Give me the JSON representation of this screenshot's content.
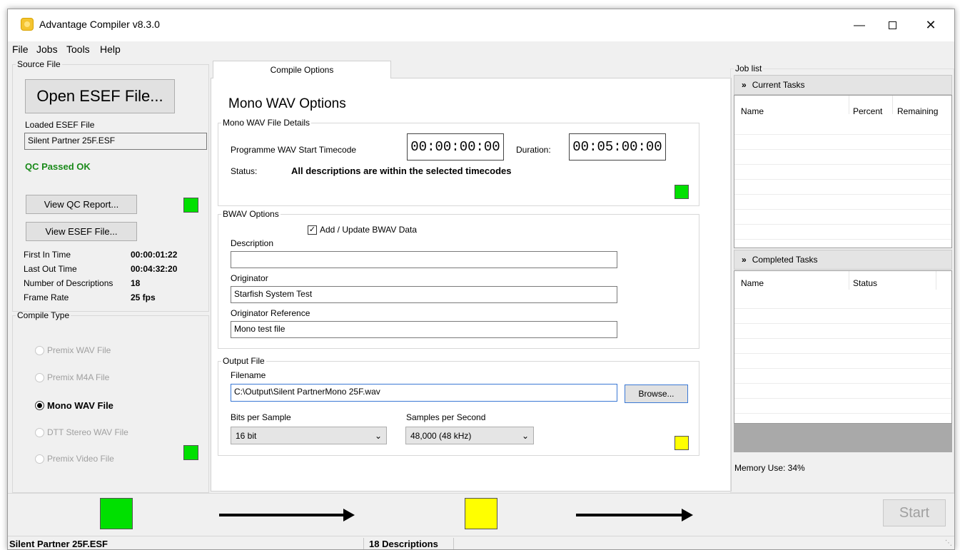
{
  "window": {
    "title": "Advantage Compiler v8.3.0"
  },
  "menu": [
    "File",
    "Jobs",
    "Tools",
    "Help"
  ],
  "source_file": {
    "legend": "Source File",
    "open_button": "Open ESEF File...",
    "loaded_label": "Loaded ESEF File",
    "loaded_value": "Silent Partner 25F.ESF",
    "qc_status": "QC Passed OK",
    "view_qc_button": "View QC Report...",
    "view_esef_button": "View ESEF File...",
    "stats": [
      {
        "label": "First In Time",
        "value": "00:00:01:22"
      },
      {
        "label": "Last Out Time",
        "value": "00:04:32:20"
      },
      {
        "label": "Number of Descriptions",
        "value": "18"
      },
      {
        "label": "Frame Rate",
        "value": "25 fps"
      }
    ]
  },
  "compile_type": {
    "legend": "Compile Type",
    "options": [
      {
        "label": "Premix WAV File"
      },
      {
        "label": "Premix M4A File"
      },
      {
        "label": "Mono WAV File"
      },
      {
        "label": "DTT Stereo WAV File"
      },
      {
        "label": "Premix Video File"
      }
    ],
    "selected": "Mono WAV File"
  },
  "tab": {
    "label": "Compile Options"
  },
  "options": {
    "heading": "Mono WAV Options",
    "details": {
      "legend": "Mono WAV File Details",
      "start_label": "Programme WAV Start Timecode",
      "start_value": "00:00:00:00",
      "duration_label": "Duration:",
      "duration_value": "00:05:00:00",
      "status_label": "Status:",
      "status_value": "All descriptions are within the selected timecodes"
    },
    "bwav": {
      "legend": "BWAV Options",
      "checkbox_label": "Add / Update BWAV Data",
      "checked": true,
      "description_label": "Description",
      "description_value": "",
      "originator_label": "Originator",
      "originator_value": "Starfish System Test",
      "reference_label": "Originator Reference",
      "reference_value": "Mono test file"
    },
    "output": {
      "legend": "Output File",
      "filename_label": "Filename",
      "filename_value": "C:\\Output\\Silent PartnerMono 25F.wav",
      "browse_button": "Browse...",
      "bits_label": "Bits per Sample",
      "bits_value": "16 bit",
      "samples_label": "Samples per Second",
      "samples_value": "48,000 (48 kHz)"
    }
  },
  "job_list": {
    "legend": "Job list",
    "current": {
      "title": "Current Tasks",
      "columns": [
        "Name",
        "Percent",
        "Remaining"
      ]
    },
    "completed": {
      "title": "Completed Tasks",
      "columns": [
        "Name",
        "Status"
      ]
    },
    "memory": "Memory Use: 34%"
  },
  "start_button": "Start",
  "statusbar": {
    "file": "Silent Partner 25F.ESF",
    "descriptions": "18 Descriptions"
  },
  "colors": {
    "ok": "#00e000",
    "warn": "#ffff00"
  }
}
